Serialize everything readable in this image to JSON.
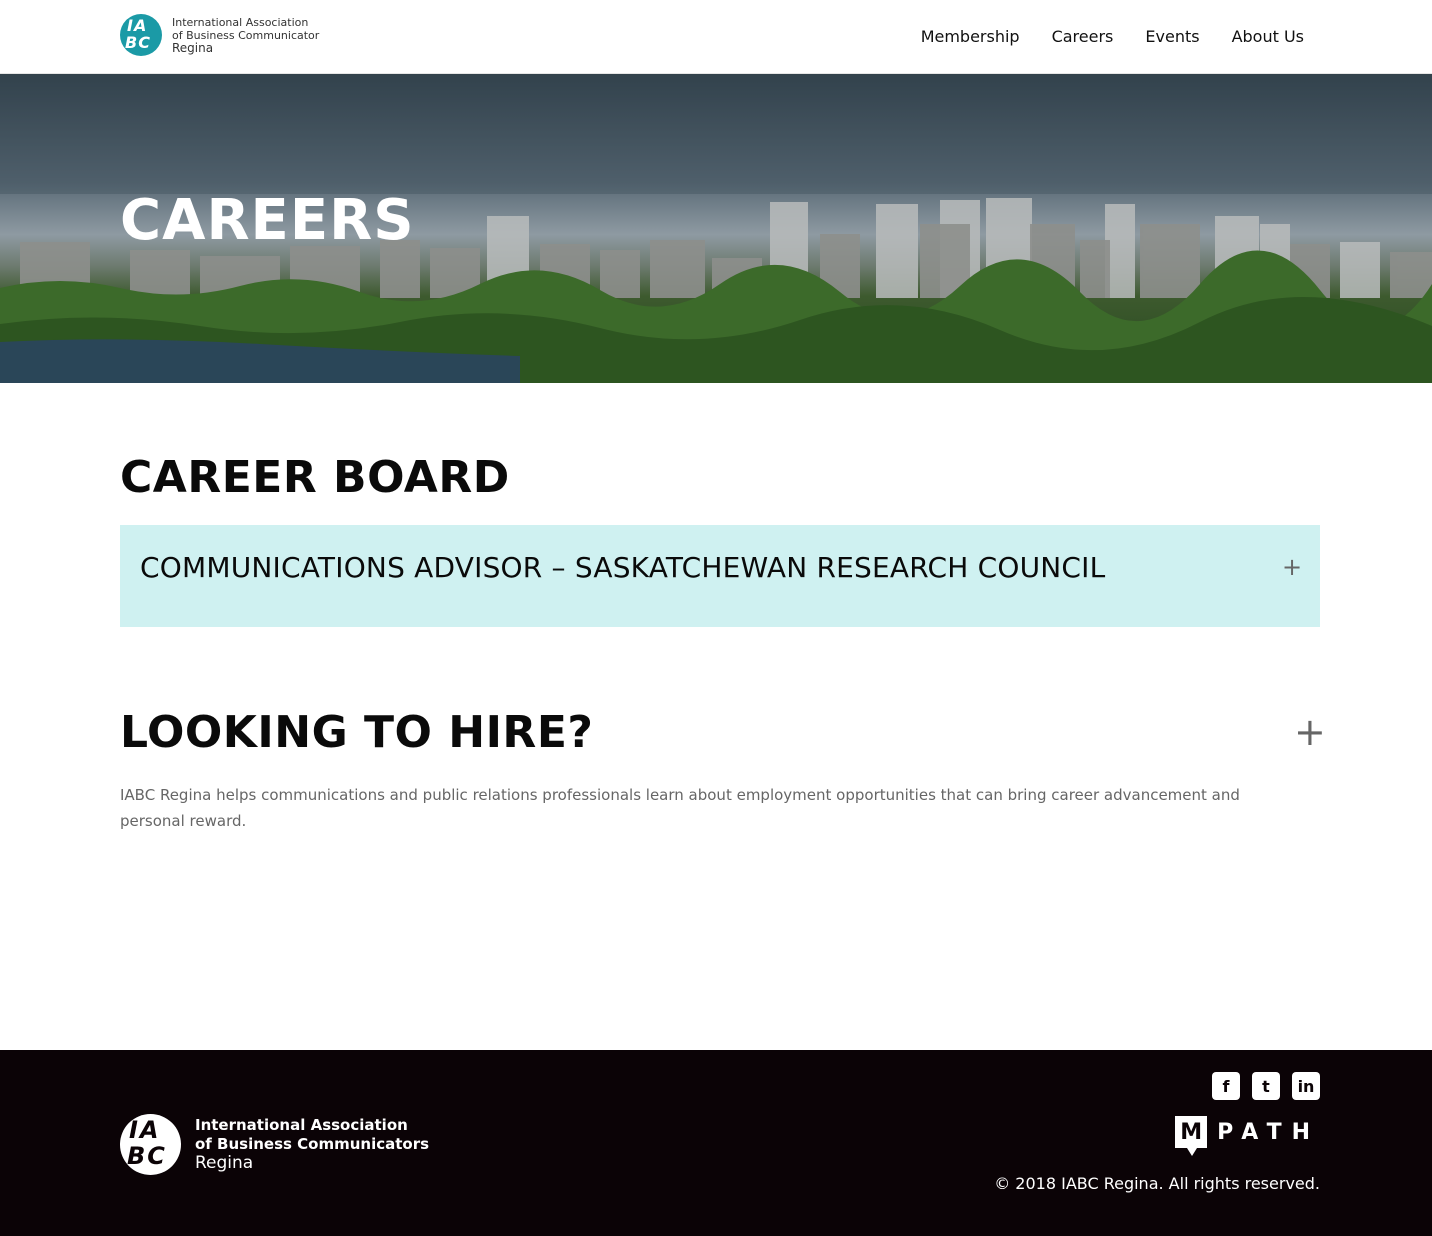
{
  "header": {
    "logo": {
      "mark_line1": "IA",
      "mark_line2": "BC",
      "line1": "International Association",
      "line2": "of Business Communicator",
      "line3": "Regina"
    },
    "nav": [
      "Membership",
      "Careers",
      "Events",
      "About Us"
    ]
  },
  "hero": {
    "title": "CAREERS"
  },
  "career_board": {
    "title": "CAREER BOARD",
    "jobs": [
      {
        "title": "COMMUNICATIONS ADVISOR – SASKATCHEWAN RESEARCH COUNCIL",
        "toggle": "+"
      }
    ]
  },
  "hire": {
    "title": "LOOKING TO HIRE?",
    "toggle": "+",
    "body": "IABC Regina helps communications and public relations professionals learn about employment opportunities that can bring career advancement and personal reward."
  },
  "footer": {
    "logo": {
      "mark_line1": "IA",
      "mark_line2": "BC",
      "line1": "International Association",
      "line2": "of Business Communicators",
      "line3": "Regina"
    },
    "social": [
      {
        "icon": "facebook-icon",
        "glyph": "f"
      },
      {
        "icon": "twitter-icon",
        "glyph": "t"
      },
      {
        "icon": "linkedin-icon",
        "glyph": "in"
      }
    ],
    "partner": {
      "mark": "M",
      "word": "PATH"
    },
    "copyright": "© 2018 IABC Regina. All rights reserved."
  },
  "colors": {
    "brand_teal": "#1b9aa6",
    "accordion_bg": "#cff1f1",
    "footer_bg": "#0b0306"
  }
}
